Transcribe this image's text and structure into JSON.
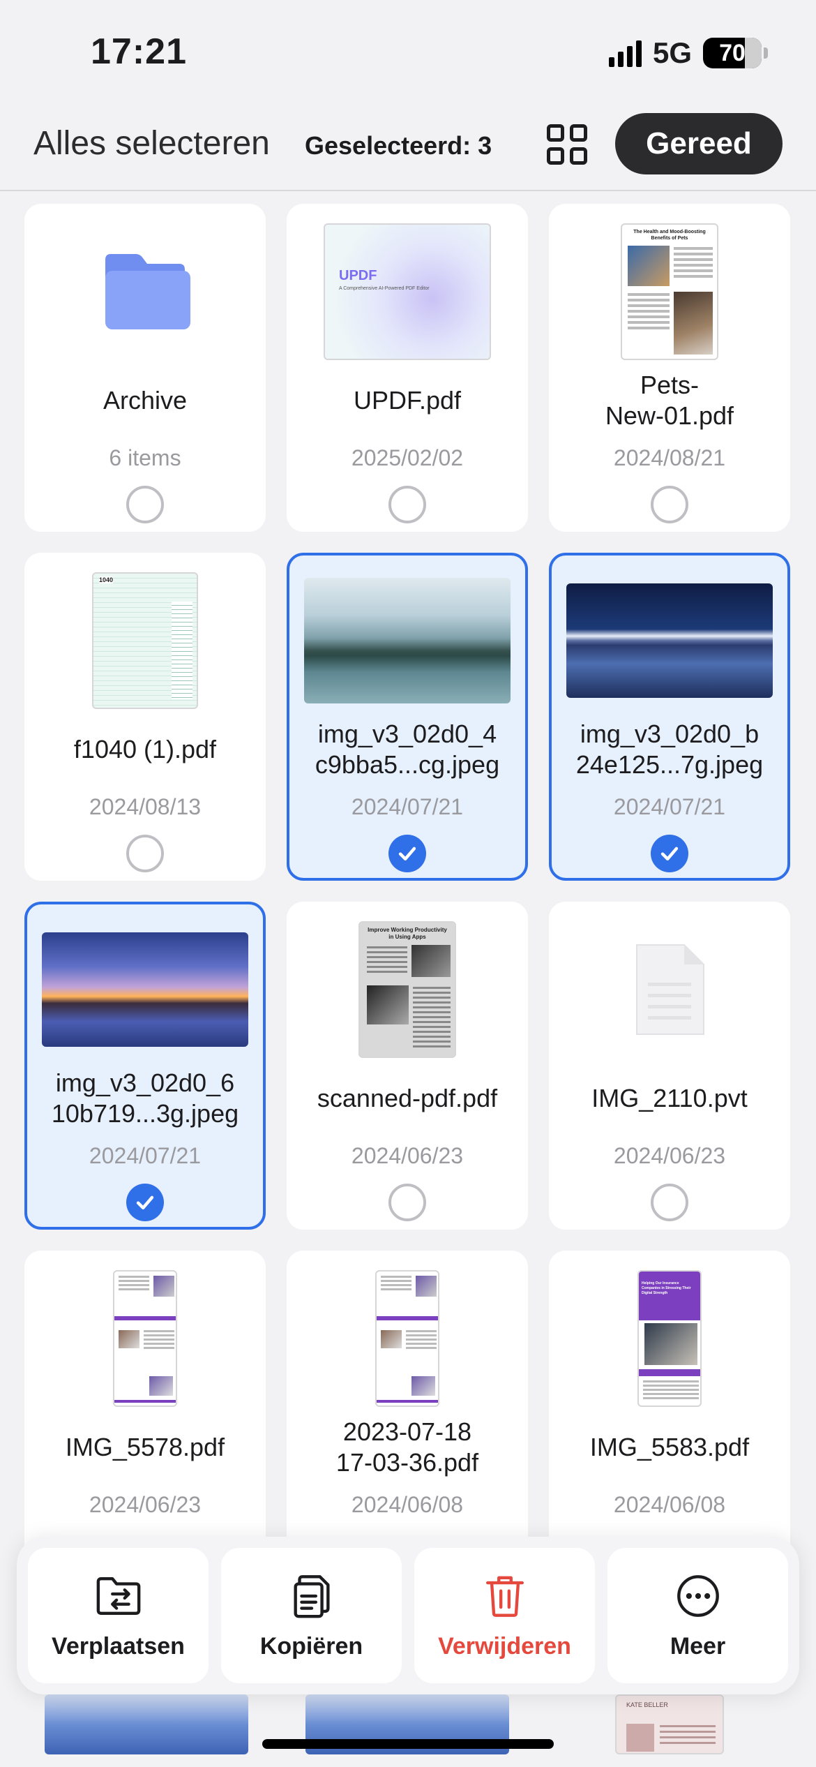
{
  "status_bar": {
    "time": "17:21",
    "network": "5G",
    "battery": "70"
  },
  "header": {
    "select_all": "Alles selecteren",
    "selected_count": "Geselecteerd: 3",
    "done": "Gereed"
  },
  "files": [
    {
      "name": "Archive",
      "meta": "6 items",
      "type": "folder",
      "selected": false
    },
    {
      "name": "UPDF.pdf",
      "meta": "2025/02/02",
      "type": "pdf",
      "selected": false,
      "thumb_title": "UPDF",
      "thumb_subtitle": "A Comprehensive AI-Powered PDF Editor"
    },
    {
      "name": "Pets-\nNew-01.pdf",
      "meta": "2024/08/21",
      "type": "pdf",
      "selected": false,
      "thumb_title": "The Health and Mood-Boosting Benefits of Pets"
    },
    {
      "name": "f1040 (1).pdf",
      "meta": "2024/08/13",
      "type": "pdf",
      "selected": false,
      "thumb_title": "1040"
    },
    {
      "name": "img_v3_02d0_4\nc9bba5...cg.jpeg",
      "meta": "2024/07/21",
      "type": "image",
      "selected": true
    },
    {
      "name": "img_v3_02d0_b\n24e125...7g.jpeg",
      "meta": "2024/07/21",
      "type": "image",
      "selected": true
    },
    {
      "name": "img_v3_02d0_6\n10b719...3g.jpeg",
      "meta": "2024/07/21",
      "type": "image",
      "selected": true
    },
    {
      "name": "scanned-pdf.pdf",
      "meta": "2024/06/23",
      "type": "pdf",
      "selected": false,
      "thumb_title": "Improve Working Productivity in Using Apps"
    },
    {
      "name": "IMG_2110.pvt",
      "meta": "2024/06/23",
      "type": "generic",
      "selected": false
    },
    {
      "name": "IMG_5578.pdf",
      "meta": "2024/06/23",
      "type": "pdf",
      "selected": false
    },
    {
      "name": "2023-07-18\n17-03-36.pdf",
      "meta": "2024/06/08",
      "type": "pdf",
      "selected": false
    },
    {
      "name": "IMG_5583.pdf",
      "meta": "2024/06/08",
      "type": "pdf",
      "selected": false,
      "thumb_title": "Helping Our Insurance Companies in Stressing Their Digital Strength"
    }
  ],
  "actions": {
    "move": "Verplaatsen",
    "copy": "Kopiëren",
    "delete": "Verwijderen",
    "more": "Meer"
  },
  "peek_thumb_title": "KATE BELLER",
  "colors": {
    "accent": "#2f6fe8",
    "danger": "#e5483c",
    "folder": "#7f9cf5",
    "selected_bg": "#e7f0fd"
  }
}
